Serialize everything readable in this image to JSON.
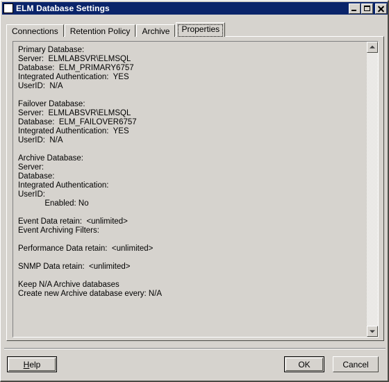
{
  "window": {
    "title": "ELM Database Settings",
    "icon": "app-window-icon",
    "controls": {
      "minimize": "minimize-icon",
      "maximize": "maximize-icon",
      "close": "close-icon"
    }
  },
  "tabs": [
    {
      "label": "Connections",
      "selected": false
    },
    {
      "label": "Retention Policy",
      "selected": false
    },
    {
      "label": "Archive",
      "selected": false
    },
    {
      "label": "Properties",
      "selected": true
    }
  ],
  "properties_text": {
    "lines": [
      "Primary Database:",
      "Server:  ELMLABSVR\\ELMSQL",
      "Database:  ELM_PRIMARY6757",
      "Integrated Authentication:  YES",
      "UserID:  N/A",
      "",
      "Failover Database:",
      "Server:  ELMLABSVR\\ELMSQL",
      "Database:  ELM_FAILOVER6757",
      "Integrated Authentication:  YES",
      "UserID:  N/A",
      "",
      "Archive Database:",
      "Server:",
      "Database:",
      "Integrated Authentication:",
      "UserID:",
      "            Enabled: No",
      "",
      "Event Data retain:  <unlimited>",
      "Event Archiving Filters:",
      "",
      "Performance Data retain:  <unlimited>",
      "",
      "SNMP Data retain:  <unlimited>",
      "",
      "Keep N/A Archive databases",
      "Create new Archive database every: N/A"
    ]
  },
  "scrollbar": {
    "up_arrow": "scroll-up-icon",
    "down_arrow": "scroll-down-icon"
  },
  "buttons": {
    "help": {
      "accel": "H",
      "rest": "elp"
    },
    "ok": "OK",
    "cancel": "Cancel"
  },
  "colors": {
    "titlebar": "#0a246a",
    "face": "#d6d3ce",
    "shadow": "#4a4a44",
    "text": "#000000"
  }
}
